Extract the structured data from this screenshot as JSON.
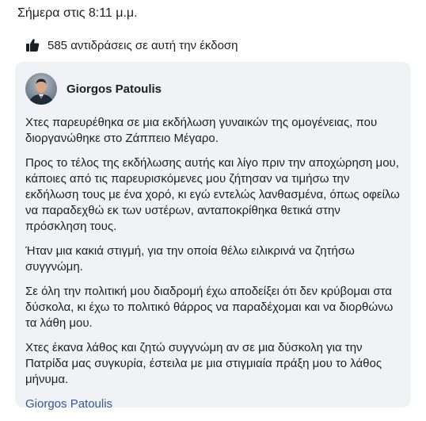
{
  "header": {
    "timestamp": "Σήμερα στις 8:11 μ.μ."
  },
  "reactions": {
    "icon": "thumbs-up-icon",
    "text": "585 αντιδράσεις σε αυτή την έκδοση"
  },
  "post": {
    "author": "Giorgos Patoulis",
    "paragraphs": [
      "Χτες παρευρέθηκα σε μια εκδήλωση γυναικών της ομογένειας, που διοργανώθηκε στο Ζάππειο Μέγαρο.",
      "Προς το τέλος της εκδήλωσης αυτής και λίγο πριν την αποχώρηση μου, κάποιες από τις παρευρισκόμενες μου ζήτησαν να τιμήσω την εκδήλωση τους με ένα χορό, κι εγώ εντελώς λανθασμένα, όπως οφείλω να παραδεχθώ εκ των υστέρων, ανταποκρίθηκα θετικά στην πρόσκληση τους.",
      "Ήταν μια κακιά στιγμή, για την οποία θέλω ειλικρινά να ζητήσω συγγνώμη.",
      "Σε όλη την πολιτική μου διαδρομή έχω αποδείξει ότι δεν κρύβομαι στα δύσκολα, κι έχω το πολιτικό θάρρος να παραδέχομαι και να διορθώνω τα λάθη μου.",
      "Χτες έκανα λάθος και ζητώ συγγνώμη αν σε μια δύσκολη για την Πατρίδα μας συγκυρία, έστειλα με μια στιγμιαία πράξη μου το λάθος μήνυμα."
    ],
    "signature": "Giorgos Patoulis"
  },
  "colors": {
    "card_background": "#f0f2f5",
    "link": "#385898",
    "text": "#1c1e21"
  }
}
